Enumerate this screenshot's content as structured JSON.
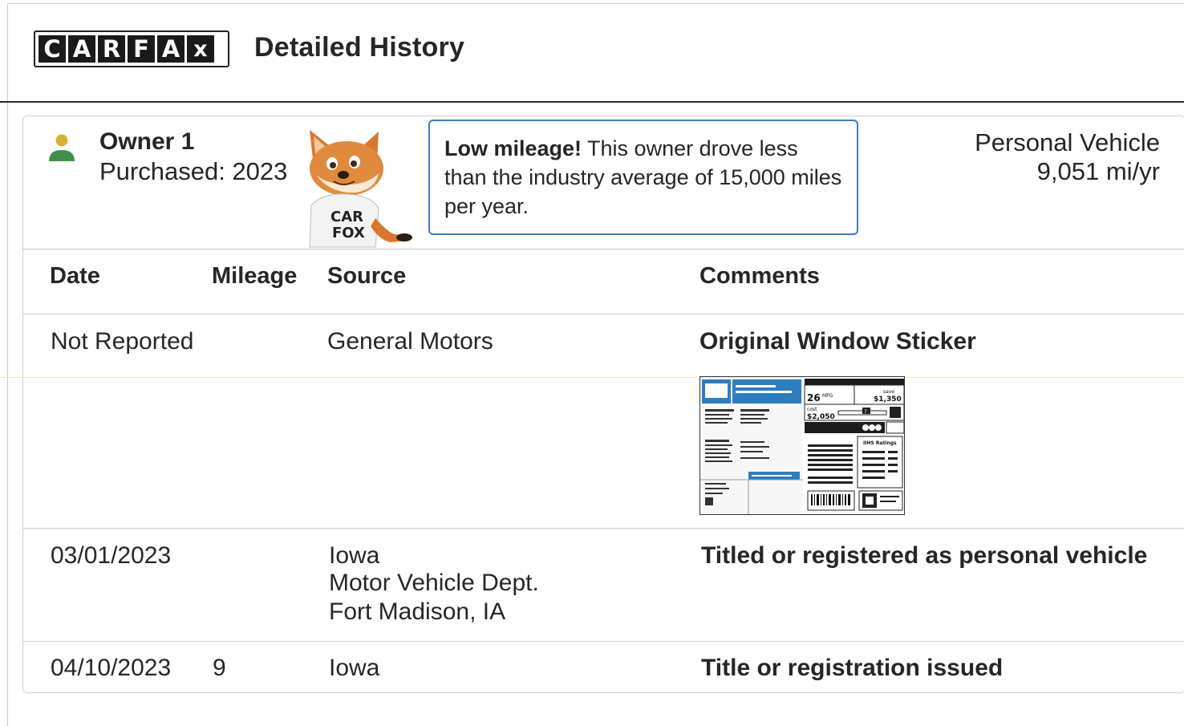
{
  "header": {
    "logo_text": "CARFAX",
    "title": "Detailed History"
  },
  "owner": {
    "name": "Owner 1",
    "purchased": "Purchased: 2023",
    "vehicle_type": "Personal Vehicle",
    "miles_per_year": "9,051 mi/yr",
    "mascot_shirt_text": "CAR FOX"
  },
  "callout": {
    "highlight": "Low mileage!",
    "text": " This owner drove less than the industry average of 15,000 miles per year."
  },
  "table": {
    "columns": [
      "Date",
      "Mileage",
      "Source",
      "Comments"
    ],
    "rows": [
      {
        "date": "Not Reported",
        "mileage": "",
        "source": [
          "General Motors"
        ],
        "comment": "Original Window Sticker"
      },
      {
        "date": "03/01/2023",
        "mileage": "",
        "source": [
          "Iowa",
          "Motor Vehicle Dept.",
          "Fort Madison, IA"
        ],
        "comment": "Titled or registered as personal vehicle"
      },
      {
        "date": "04/10/2023",
        "mileage": "9",
        "source": [
          "Iowa"
        ],
        "comment": "Title or registration issued"
      }
    ]
  },
  "sticker": {
    "mpg": "26",
    "mpg_unit": "MPG",
    "save_label": "save",
    "save_value": "$1,350",
    "cost_label": "cost",
    "cost_value": "$2,050",
    "rating_value": "7",
    "iihs_label": "IIHS Ratings"
  },
  "colors": {
    "callout_border": "#3b7bbf",
    "owner_icon_head": "#d6b13a",
    "owner_icon_body": "#3f8f4a",
    "sticker_blue": "#2e7dc0"
  }
}
